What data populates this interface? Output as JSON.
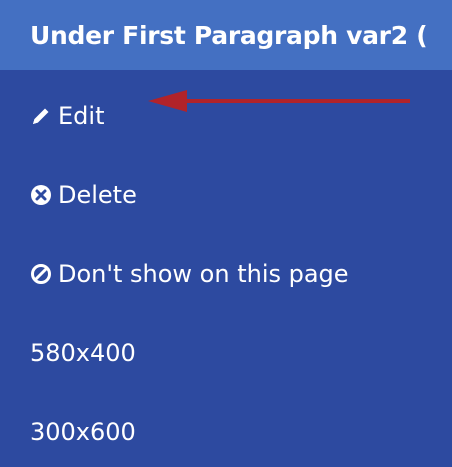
{
  "header": {
    "title": "Under First Paragraph var2 ("
  },
  "menu": {
    "items": [
      {
        "label": "Edit",
        "icon": "pencil-icon"
      },
      {
        "label": "Delete",
        "icon": "circle-x-icon"
      },
      {
        "label": "Don't show on this page",
        "icon": "ban-icon"
      },
      {
        "label": "580x400"
      },
      {
        "label": "300x600"
      }
    ]
  },
  "colors": {
    "background": "#2d4aa0",
    "header_background": "#4470c2",
    "text": "#ffffff",
    "annotation_arrow": "#b1232a"
  }
}
